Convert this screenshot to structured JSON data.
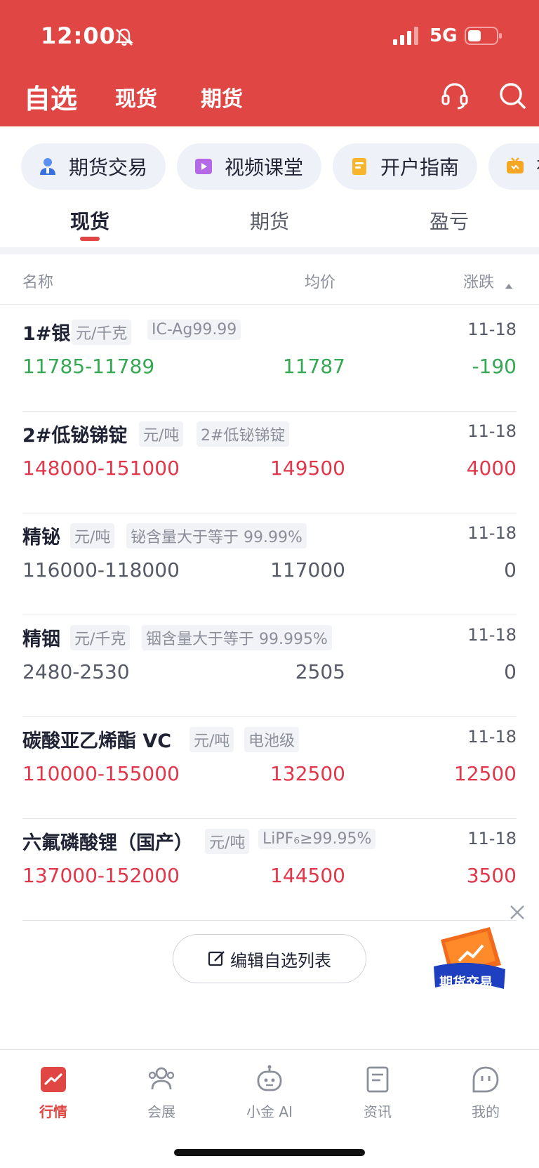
{
  "status_bar": {
    "time": "12:00",
    "network": "5G"
  },
  "nav": {
    "tabs": [
      {
        "label": "自选"
      },
      {
        "label": "现货"
      },
      {
        "label": "期货"
      }
    ]
  },
  "quick_links": [
    {
      "label": "期货交易",
      "icon": "trader-icon"
    },
    {
      "label": "视频课堂",
      "icon": "video-icon"
    },
    {
      "label": "开户指南",
      "icon": "guide-icon"
    },
    {
      "label": "有",
      "icon": "tv-icon"
    }
  ],
  "section_tabs": [
    {
      "label": "现货"
    },
    {
      "label": "期货"
    },
    {
      "label": "盈亏"
    }
  ],
  "columns": {
    "name": "名称",
    "avg": "均价",
    "change": "涨跌"
  },
  "rows": [
    {
      "name": "1#银",
      "unit": "元/千克",
      "spec": "IC-Ag99.99",
      "date": "11-18",
      "range": "11785-11789",
      "avg": "11787",
      "change": "-190",
      "trend": "down"
    },
    {
      "name": "2#低铋锑锭",
      "unit": "元/吨",
      "spec": "2#低铋锑锭",
      "date": "11-18",
      "range": "148000-151000",
      "avg": "149500",
      "change": "4000",
      "trend": "up"
    },
    {
      "name": "精铋",
      "unit": "元/吨",
      "spec": "铋含量大于等于 99.99%",
      "date": "11-18",
      "range": "116000-118000",
      "avg": "117000",
      "change": "0",
      "trend": "flat"
    },
    {
      "name": "精铟",
      "unit": "元/千克",
      "spec": "铟含量大于等于 99.995%",
      "date": "11-18",
      "range": "2480-2530",
      "avg": "2505",
      "change": "0",
      "trend": "flat"
    },
    {
      "name": "碳酸亚乙烯酯 VC",
      "unit": "元/吨",
      "spec": "电池级",
      "date": "11-18",
      "range": "110000-155000",
      "avg": "132500",
      "change": "12500",
      "trend": "up"
    },
    {
      "name": "六氟磷酸锂（国产）",
      "unit": "元/吨",
      "spec": "LiPF₆≥99.95%",
      "date": "11-18",
      "range": "137000-152000",
      "avg": "144500",
      "change": "3500",
      "trend": "up"
    }
  ],
  "edit_button": {
    "label": "编辑自选列表"
  },
  "promo": {
    "label": "期货交易"
  },
  "tabbar": [
    {
      "label": "行情",
      "icon": "chart-icon"
    },
    {
      "label": "会展",
      "icon": "people-icon"
    },
    {
      "label": "小金 AI",
      "icon": "robot-icon"
    },
    {
      "label": "资讯",
      "icon": "news-icon"
    },
    {
      "label": "我的",
      "icon": "profile-icon"
    }
  ],
  "colors": {
    "brand": "#e04744",
    "up": "#e2364a",
    "down": "#34a853",
    "flat": "#555a66"
  }
}
